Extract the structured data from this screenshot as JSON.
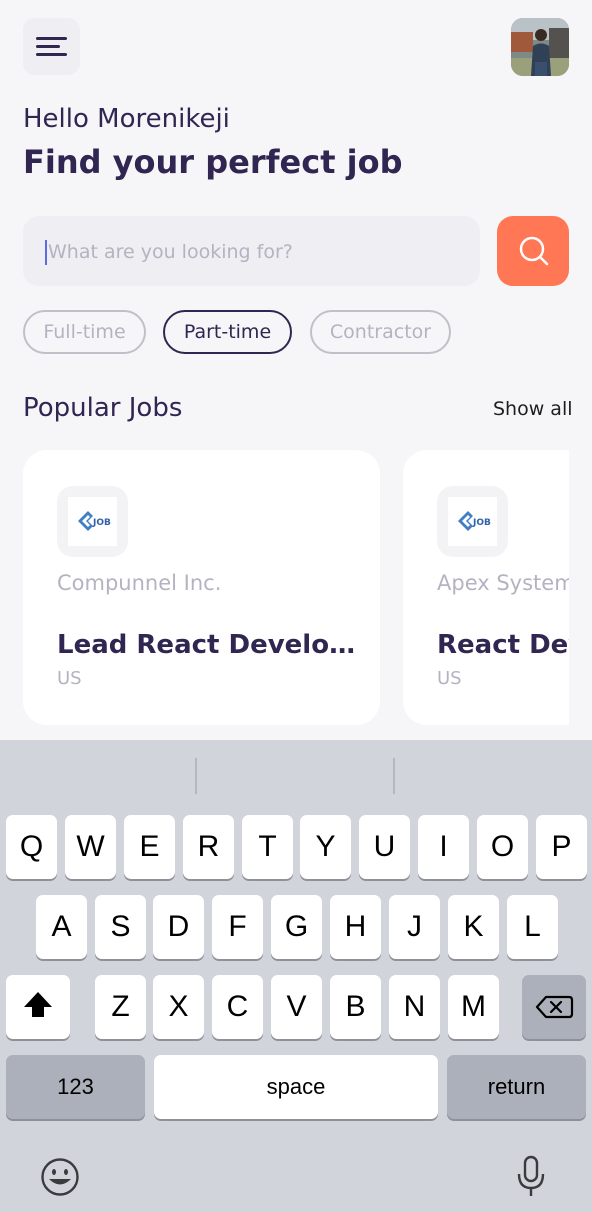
{
  "header": {
    "menu_icon": "hamburger-menu-icon",
    "avatar_icon": "profile-photo"
  },
  "welcome": {
    "greeting": "Hello Morenikeji",
    "headline": "Find your perfect job"
  },
  "search": {
    "placeholder": "What are you looking for?",
    "value": "",
    "button_icon": "search-icon",
    "accent_color": "#ff7754"
  },
  "job_types": [
    {
      "label": "Full-time",
      "active": false
    },
    {
      "label": "Part-time",
      "active": true
    },
    {
      "label": "Contractor",
      "active": false
    }
  ],
  "popular_jobs": {
    "title": "Popular Jobs",
    "show_all_label": "Show all",
    "cards": [
      {
        "company": "Compunnel Inc.",
        "title": "Lead React Develop...",
        "location": "US",
        "logo_text": "JOB"
      },
      {
        "company": "Apex Systems",
        "title": "React Developer",
        "location": "US",
        "logo_text": "JOB"
      }
    ]
  },
  "keyboard": {
    "row1": [
      "Q",
      "W",
      "E",
      "R",
      "T",
      "Y",
      "U",
      "I",
      "O",
      "P"
    ],
    "row2": [
      "A",
      "S",
      "D",
      "F",
      "G",
      "H",
      "J",
      "K",
      "L"
    ],
    "row3": [
      "Z",
      "X",
      "C",
      "V",
      "B",
      "N",
      "M"
    ],
    "numbers_label": "123",
    "space_label": "space",
    "return_label": "return",
    "shift_icon": "shift-icon",
    "backspace_icon": "backspace-icon",
    "emoji_icon": "emoji-icon",
    "mic_icon": "microphone-icon"
  }
}
